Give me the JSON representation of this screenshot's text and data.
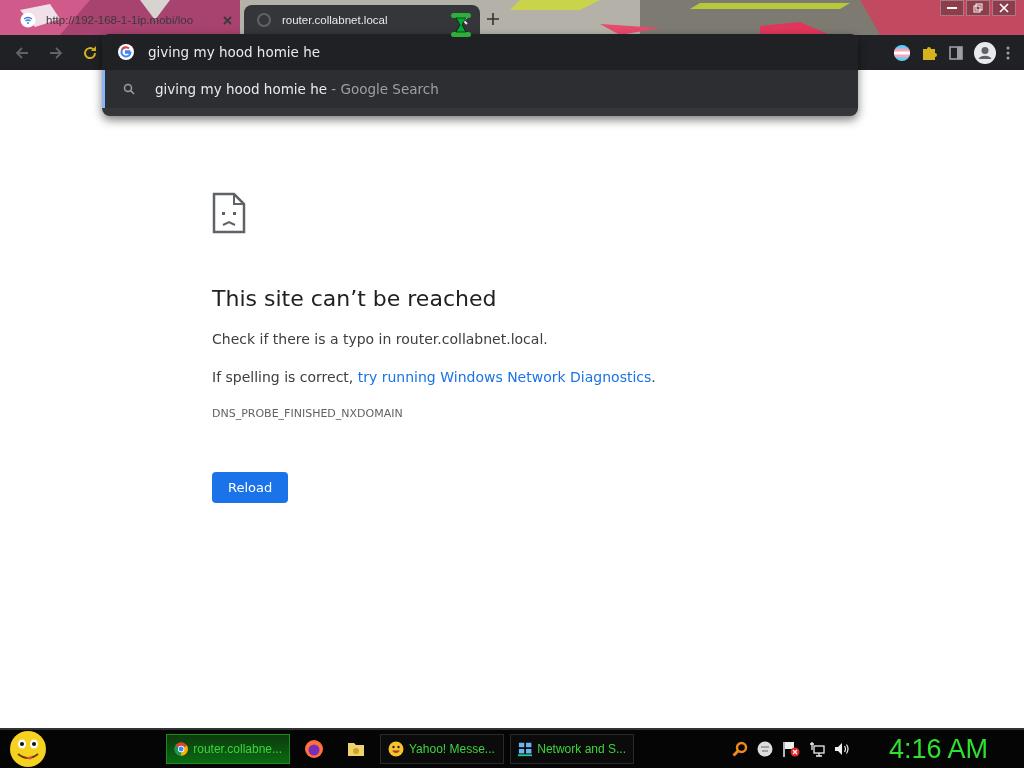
{
  "tabs": [
    {
      "title": "http://192-168-1-1ip.mobi/loo",
      "selected": false
    },
    {
      "title": "router.collabnet.local",
      "selected": true
    }
  ],
  "omnibox": {
    "value": "giving my hood homie he"
  },
  "suggestions": [
    {
      "text": "giving my hood homie he",
      "source": "- Google Search"
    }
  ],
  "error_page": {
    "heading": "This site can’t be reached",
    "message": "Check if there is a typo in router.collabnet.local.",
    "hint_prefix": "If spelling is correct, ",
    "hint_link": "try running Windows Network Diagnostics",
    "hint_suffix": ".",
    "error_code": "DNS_PROBE_FINISHED_NXDOMAIN",
    "button": "Reload"
  },
  "taskbar": {
    "buttons": [
      {
        "kind": "window",
        "label": "router.collabne...",
        "selected": true
      },
      {
        "kind": "pinned",
        "selected": false
      },
      {
        "kind": "pinned",
        "selected": false
      },
      {
        "kind": "window",
        "label": "Yahoo! Messe...",
        "selected": false
      },
      {
        "kind": "window",
        "label": "Network and S...",
        "selected": false
      }
    ],
    "clock": "4:16 AM"
  }
}
